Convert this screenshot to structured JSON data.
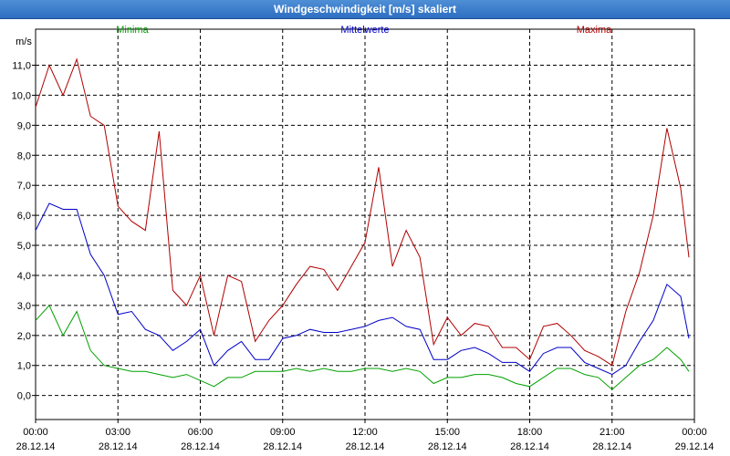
{
  "window": {
    "title": "Windgeschwindigkeit [m/s] skaliert"
  },
  "chart_data": {
    "type": "line",
    "title": "Windgeschwindigkeit [m/s] skaliert",
    "ylabel": "m/s",
    "ylim": [
      -0.8,
      12.2
    ],
    "yticks": [
      "0,0",
      "1,0",
      "2,0",
      "3,0",
      "4,0",
      "5,0",
      "6,0",
      "7,0",
      "8,0",
      "9,0",
      "10,0",
      "11,0"
    ],
    "ytick_values": [
      0,
      1,
      2,
      3,
      4,
      5,
      6,
      7,
      8,
      9,
      10,
      11
    ],
    "xlim": [
      0,
      24
    ],
    "xticks": [
      {
        "time": "00:00",
        "date": "28.12.14"
      },
      {
        "time": "03:00",
        "date": "28.12.14"
      },
      {
        "time": "06:00",
        "date": "28.12.14"
      },
      {
        "time": "09:00",
        "date": "28.12.14"
      },
      {
        "time": "12:00",
        "date": "28.12.14"
      },
      {
        "time": "15:00",
        "date": "28.12.14"
      },
      {
        "time": "18:00",
        "date": "28.12.14"
      },
      {
        "time": "21:00",
        "date": "28.12.14"
      },
      {
        "time": "00:00",
        "date": "29.12.14"
      }
    ],
    "xtick_values": [
      0,
      3,
      6,
      9,
      12,
      15,
      18,
      21,
      24
    ],
    "grid": true,
    "legend_position": "top",
    "x": [
      0,
      0.5,
      1,
      1.5,
      2,
      2.5,
      3,
      3.5,
      4,
      4.5,
      5,
      5.5,
      6,
      6.5,
      7,
      7.5,
      8,
      8.5,
      9,
      9.5,
      10,
      10.5,
      11,
      11.5,
      12,
      12.5,
      13,
      13.5,
      14,
      14.5,
      15,
      15.5,
      16,
      16.5,
      17,
      17.5,
      18,
      18.5,
      19,
      19.5,
      20,
      20.5,
      21,
      21.5,
      22,
      22.5,
      23,
      23.5,
      23.8
    ],
    "series": [
      {
        "name": "Minima",
        "color": "#00a000",
        "values": [
          2.5,
          3.0,
          2.0,
          2.8,
          1.5,
          1.0,
          0.9,
          0.8,
          0.8,
          0.7,
          0.6,
          0.7,
          0.5,
          0.3,
          0.6,
          0.6,
          0.8,
          0.8,
          0.8,
          0.9,
          0.8,
          0.9,
          0.8,
          0.8,
          0.9,
          0.9,
          0.8,
          0.9,
          0.8,
          0.4,
          0.6,
          0.6,
          0.7,
          0.7,
          0.6,
          0.4,
          0.3,
          0.6,
          0.9,
          0.9,
          0.7,
          0.6,
          0.2,
          0.6,
          1.0,
          1.2,
          1.6,
          1.2,
          0.8
        ]
      },
      {
        "name": "Mittelwerte",
        "color": "#0000c8",
        "values": [
          5.5,
          6.4,
          6.2,
          6.2,
          4.7,
          4.0,
          2.7,
          2.8,
          2.2,
          2.0,
          1.5,
          1.8,
          2.2,
          1.0,
          1.5,
          1.8,
          1.2,
          1.2,
          1.9,
          2.0,
          2.2,
          2.1,
          2.1,
          2.2,
          2.3,
          2.5,
          2.6,
          2.3,
          2.2,
          1.2,
          1.2,
          1.5,
          1.6,
          1.4,
          1.1,
          1.1,
          0.8,
          1.4,
          1.6,
          1.6,
          1.1,
          0.9,
          0.7,
          1.0,
          1.8,
          2.5,
          3.7,
          3.3,
          1.9
        ]
      },
      {
        "name": "Maxima",
        "color": "#b00000",
        "values": [
          9.6,
          11.0,
          10.0,
          11.2,
          9.3,
          9.0,
          6.3,
          5.8,
          5.5,
          8.8,
          3.5,
          3.0,
          4.0,
          2.0,
          4.0,
          3.8,
          1.8,
          2.5,
          3.0,
          3.7,
          4.3,
          4.2,
          3.5,
          4.3,
          5.1,
          7.6,
          4.3,
          5.5,
          4.6,
          1.7,
          2.6,
          2.0,
          2.4,
          2.3,
          1.6,
          1.6,
          1.2,
          2.3,
          2.4,
          2.0,
          1.5,
          1.3,
          1.0,
          2.8,
          4.1,
          6.0,
          8.9,
          6.9,
          4.6
        ]
      }
    ]
  }
}
